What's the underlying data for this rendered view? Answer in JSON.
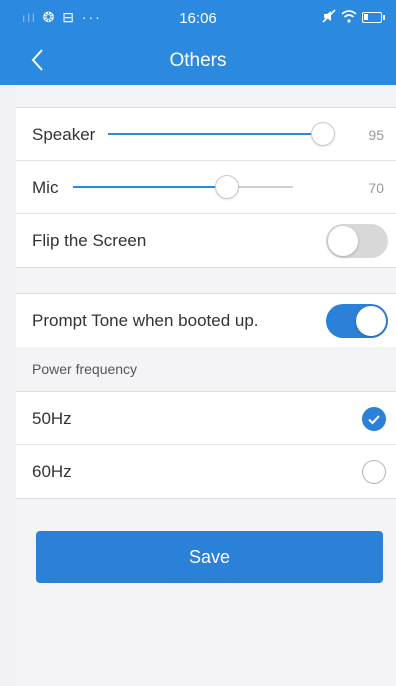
{
  "status_bar": {
    "left_icons": "ıll ❂ ⊟ ···",
    "time": "16:06",
    "icons": [
      "signal-icon",
      "weibo-icon",
      "notification-icon",
      "more-icon",
      "mute-icon",
      "wifi-icon",
      "battery-icon"
    ]
  },
  "nav": {
    "title": "Others",
    "back_icon": "chevron-left-icon"
  },
  "audio": {
    "speaker": {
      "label": "Speaker",
      "value": "95",
      "level": 0.95
    },
    "mic": {
      "label": "Mic",
      "value": "70",
      "level": 0.7
    },
    "flip": {
      "label": "Flip the Screen",
      "on": false
    }
  },
  "prompt_tone": {
    "label": "Prompt Tone when booted up.",
    "on": true
  },
  "power_frequency": {
    "header": "Power frequency",
    "options": [
      {
        "label": "50Hz",
        "selected": true
      },
      {
        "label": "60Hz",
        "selected": false
      }
    ]
  },
  "save_label": "Save",
  "colors": {
    "accent": "#2b8ae0",
    "toggle_on": "#2b80d8",
    "toggle_off": "#d8d8d8",
    "background": "#f2f2f4"
  }
}
